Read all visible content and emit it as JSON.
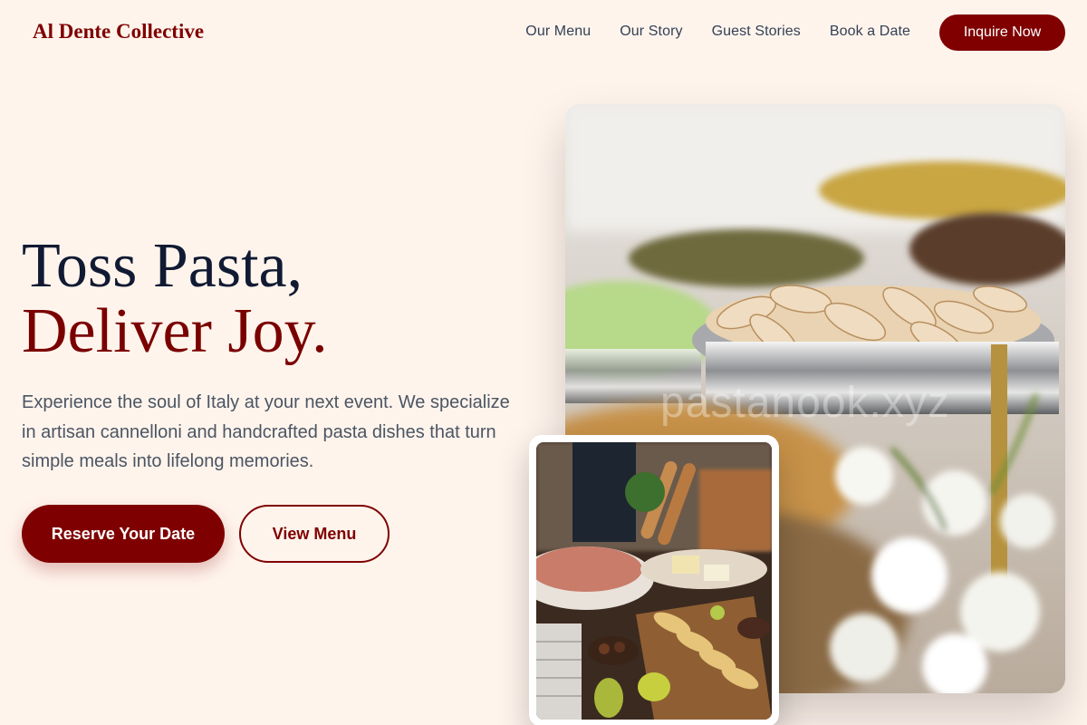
{
  "brand": {
    "name": "Al Dente Collective"
  },
  "nav": {
    "links": [
      "Our Menu",
      "Our Story",
      "Guest Stories",
      "Book a Date"
    ],
    "cta": "Inquire Now"
  },
  "hero": {
    "title_line1": "Toss Pasta,",
    "title_line2": "Deliver Joy.",
    "description": "Experience the soul of Italy at your next event. We specialize in artisan cannelloni and handcrafted pasta dishes that turn simple meals into lifelong memories.",
    "primary_button": "Reserve Your Date",
    "secondary_button": "View Menu"
  },
  "images": {
    "main_watermark": "pastanook.xyz"
  },
  "colors": {
    "accent": "#7f0000",
    "background": "#fff4ec",
    "heading": "#111a33"
  }
}
